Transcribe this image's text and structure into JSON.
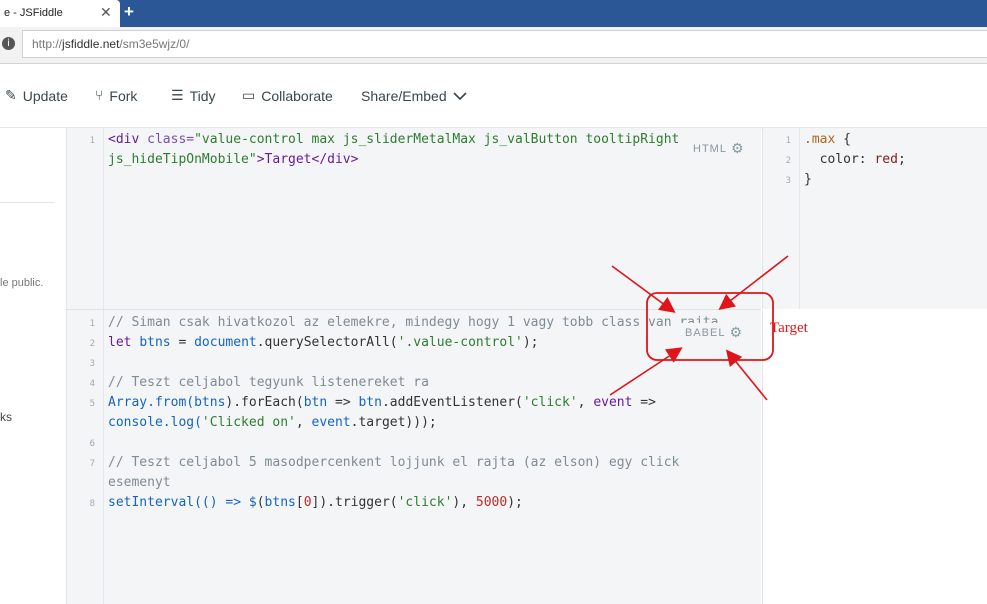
{
  "browser": {
    "tab_title": "e - JSFiddle",
    "tab_close": "✕",
    "new_tab": "+",
    "url_prefix": "http://",
    "url_host": "jsfiddle.net",
    "url_path": "/sm3e5wjz/0/"
  },
  "toolbar": {
    "update": "Update",
    "fork": "Fork",
    "tidy": "Tidy",
    "collaborate": "Collaborate",
    "share": "Share/Embed"
  },
  "sidebar": {
    "public_text": "le public.",
    "ks_text": "ks"
  },
  "html_panel": {
    "label": "HTML",
    "line_numbers": [
      "1"
    ],
    "line1_a": "<div ",
    "line1_attr": "class=",
    "line1_str": "\"value-control max js_sliderMetalMax js_valButton tooltipRight",
    "line1_b_str": "js_hideTipOnMobile\"",
    "line1_b_rest": ">Target</div>"
  },
  "css_panel": {
    "line_numbers": [
      "1",
      "2",
      "3"
    ],
    "sel": ".max",
    "brace_open": " {",
    "prop": "  color: ",
    "val": "red",
    "semi": ";",
    "brace_close": "}"
  },
  "js_panel": {
    "label": "BABEL",
    "line_numbers": [
      "1",
      "2",
      "3",
      "4",
      "5",
      "6",
      "7",
      "8"
    ],
    "l1": "// Siman csak hivatkozol az elemekre, mindegy hogy 1 vagy tobb class van rajta",
    "l2_kw": "let ",
    "l2_var": "btns",
    "l2_eq": " = ",
    "l2_doc": "document",
    "l2_call": ".querySelectorAll(",
    "l2_str": "'.value-control'",
    "l2_end": ");",
    "l4": "// Teszt celjabol tegyunk listenereket ra",
    "l5_a": "Array.from(",
    "l5_var": "btns",
    "l5_b": ").forEach(",
    "l5_btn": "btn",
    "l5_c": " => ",
    "l5_btn2": "btn",
    "l5_d": ".addEventListener(",
    "l5_str": "'click'",
    "l5_e": ", ",
    "l5_ev": "event",
    "l5_f": " =>",
    "l5b_a": "console.log(",
    "l5b_str": "'Clicked on'",
    "l5b_b": ", ",
    "l5b_ev": "event",
    "l5b_c": ".target)));",
    "l7": "// Teszt celjabol 5 masodpercenkent lojjunk el rajta (az elson) egy click",
    "l7b": "esemenyt",
    "l8_a": "setInterval(() => ",
    "l8_dollar": "$",
    "l8_b": "(",
    "l8_var": "btns",
    "l8_c": "[",
    "l8_num0": "0",
    "l8_d": "]).trigger(",
    "l8_str": "'click'",
    "l8_e": "), ",
    "l8_num": "5000",
    "l8_f": ");"
  },
  "annotation": {
    "label": "Target",
    "color": "#e0141b"
  }
}
